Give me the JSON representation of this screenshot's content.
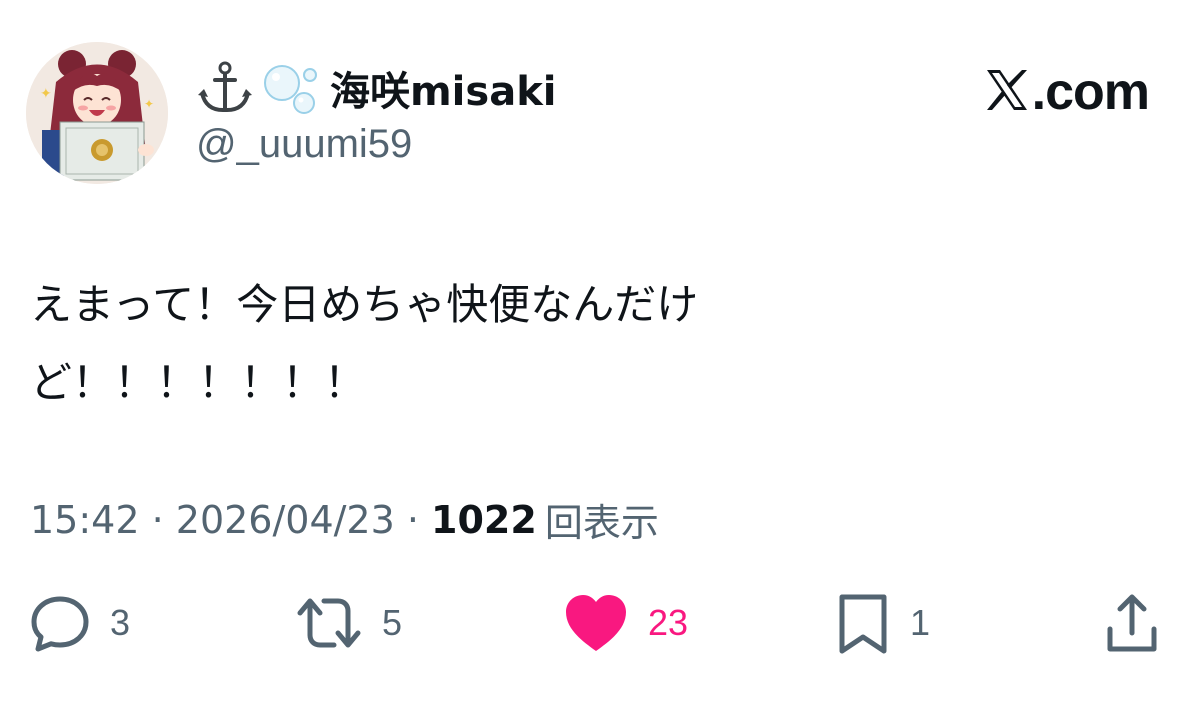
{
  "user": {
    "display_name": "海咲misaki",
    "name_emojis": [
      "anchor-icon",
      "bubbles-icon"
    ],
    "handle": "@_uuumi59",
    "avatar": "avatar-image"
  },
  "brand": {
    "label": ".com",
    "logo": "x-logo-icon"
  },
  "tweet": {
    "text_line_1": "えまって！今日めちゃ快便なんだけ",
    "text_line_2": "ど！！！！！！！"
  },
  "meta": {
    "time": "15:42",
    "separator": " · ",
    "date": "2026/04/23",
    "views_count": "1022",
    "views_label": "回表示"
  },
  "actions": {
    "reply_count": "3",
    "retweet_count": "5",
    "like_count": "23",
    "bookmark_count": "1"
  },
  "colors": {
    "text": "#0f1419",
    "muted": "#536471",
    "like": "#f91880"
  }
}
